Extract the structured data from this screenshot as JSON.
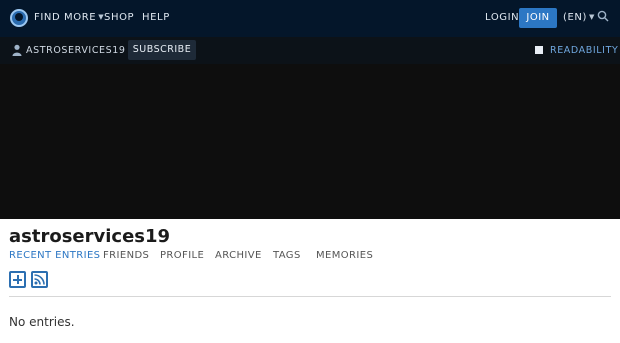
{
  "topnav": {
    "links": [
      {
        "label": "FIND MORE",
        "has_caret": true
      },
      {
        "label": "SHOP"
      },
      {
        "label": "HELP"
      }
    ],
    "login_label": "LOGIN",
    "join_label": "JOIN",
    "language_label": "(EN)"
  },
  "subbar": {
    "username": "ASTROSERVICES19",
    "subscribe_label": "SUBSCRIBE",
    "readability_label": "READABILITY"
  },
  "journal": {
    "title": "astroservices19",
    "tabs": [
      {
        "label": "RECENT ENTRIES",
        "active": true
      },
      {
        "label": "FRIENDS"
      },
      {
        "label": "PROFILE"
      },
      {
        "label": "ARCHIVE"
      },
      {
        "label": "TAGS"
      },
      {
        "label": "MEMORIES"
      }
    ],
    "action_icons": [
      "plus-icon",
      "rss-icon"
    ],
    "empty_message": "No entries."
  },
  "colors": {
    "topbar_bg": "#04162a",
    "accent": "#2c77c4",
    "hero_bg": "#0e0e0e"
  }
}
